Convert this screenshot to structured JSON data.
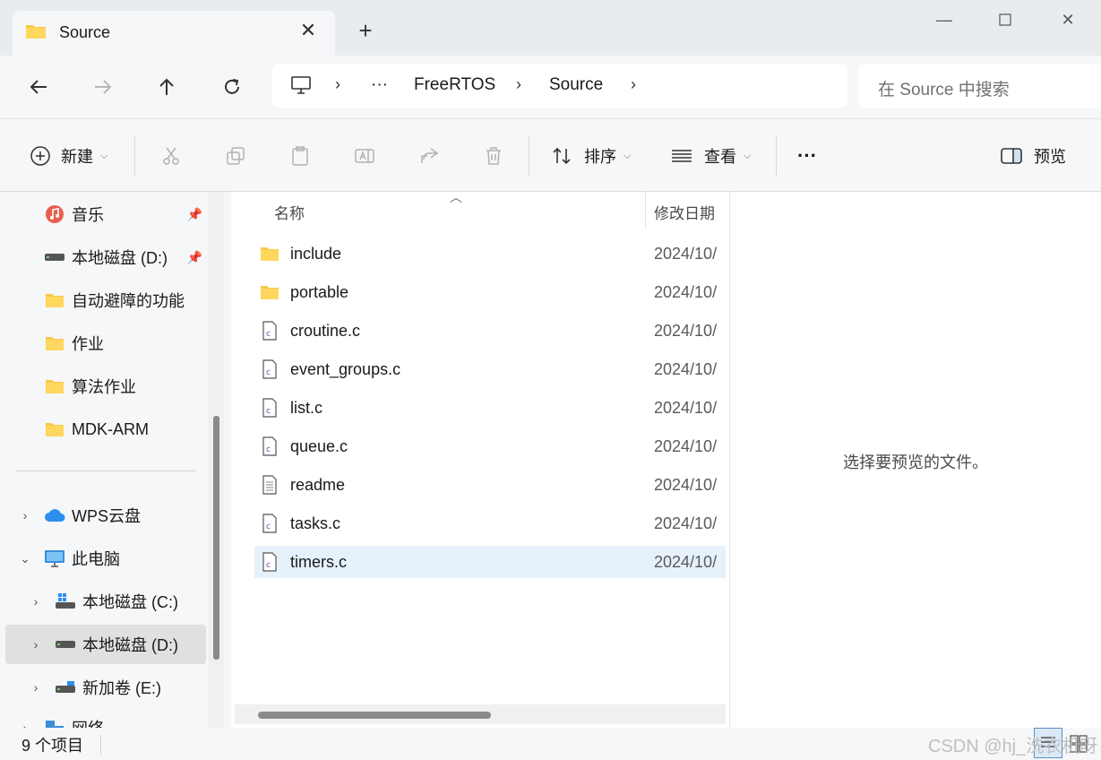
{
  "window": {
    "tab_title": "Source",
    "tab_icon": "folder-icon",
    "controls": [
      "minimize-icon",
      "maximize-icon",
      "close-icon"
    ]
  },
  "nav": {
    "back": "back-arrow-icon",
    "forward": "forward-arrow-icon",
    "up": "up-arrow-icon",
    "refresh": "refresh-icon"
  },
  "address": {
    "root_icon": "this-pc-icon",
    "overflow": "···",
    "crumbs": [
      "FreeRTOS",
      "Source"
    ]
  },
  "search": {
    "placeholder": "在 Source 中搜索"
  },
  "toolbar": {
    "new_label": "新建",
    "sort_label": "排序",
    "view_label": "查看",
    "more_label": "···",
    "preview_label": "预览"
  },
  "sidebar": {
    "items": [
      {
        "label": "音乐",
        "icon": "music-icon",
        "pinned": true
      },
      {
        "label": "本地磁盘 (D:)",
        "icon": "drive-icon",
        "pinned": true
      },
      {
        "label": "自动避障的功能",
        "icon": "folder-icon"
      },
      {
        "label": "作业",
        "icon": "folder-icon"
      },
      {
        "label": "算法作业",
        "icon": "folder-icon"
      },
      {
        "label": "MDK-ARM",
        "icon": "folder-icon"
      },
      {
        "label": "WPS云盘",
        "icon": "cloud-icon"
      },
      {
        "label": "此电脑",
        "icon": "computer-icon"
      },
      {
        "label": "本地磁盘 (C:)",
        "icon": "windows-drive-icon"
      },
      {
        "label": "本地磁盘 (D:)",
        "icon": "drive-icon",
        "selected": true
      },
      {
        "label": "新加卷 (E:)",
        "icon": "drive-icon"
      },
      {
        "label": "网络",
        "icon": "network-icon"
      }
    ]
  },
  "files": {
    "columns": {
      "name": "名称",
      "date": "修改日期"
    },
    "rows": [
      {
        "name": "include",
        "type": "folder",
        "date": "2024/10/"
      },
      {
        "name": "portable",
        "type": "folder",
        "date": "2024/10/"
      },
      {
        "name": "croutine.c",
        "type": "c-file",
        "date": "2024/10/"
      },
      {
        "name": "event_groups.c",
        "type": "c-file",
        "date": "2024/10/"
      },
      {
        "name": "list.c",
        "type": "c-file",
        "date": "2024/10/"
      },
      {
        "name": "queue.c",
        "type": "c-file",
        "date": "2024/10/"
      },
      {
        "name": "readme",
        "type": "text-file",
        "date": "2024/10/"
      },
      {
        "name": "tasks.c",
        "type": "c-file",
        "date": "2024/10/"
      },
      {
        "name": "timers.c",
        "type": "c-file",
        "date": "2024/10/",
        "selected": true
      }
    ]
  },
  "preview": {
    "message": "选择要预览的文件。"
  },
  "status": {
    "count": "9 个项目",
    "watermark": "CSDN @hj_洗衣机呀"
  },
  "colors": {
    "folder": "#f7c948",
    "selection": "#e5f1fb",
    "accent": "#0067c0"
  }
}
